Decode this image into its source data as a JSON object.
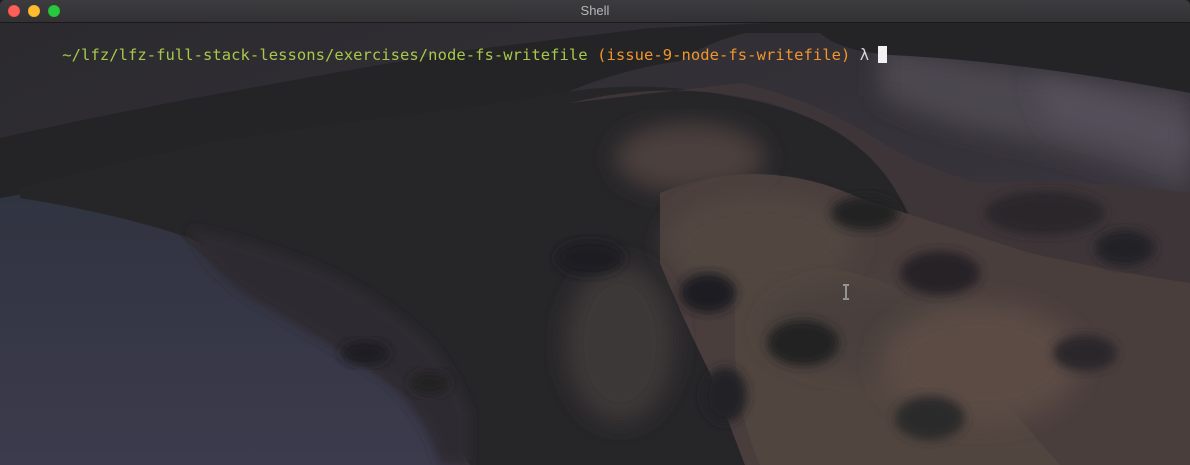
{
  "window": {
    "title": "Shell"
  },
  "terminal": {
    "path": "~/lfz/lfz-full-stack-lessons/exercises/node-fs-writefile",
    "branch": "(issue-9-node-fs-writefile)",
    "prompt_symbol": "λ"
  },
  "colors": {
    "path": "#a6c94a",
    "branch": "#f0962c",
    "close": "#fe5f57",
    "minimize": "#febc2e",
    "zoom": "#28c840"
  },
  "icons": {
    "close": "close-icon",
    "minimize": "minimize-icon",
    "zoom": "zoom-icon",
    "pointer": "text-cursor-icon"
  }
}
